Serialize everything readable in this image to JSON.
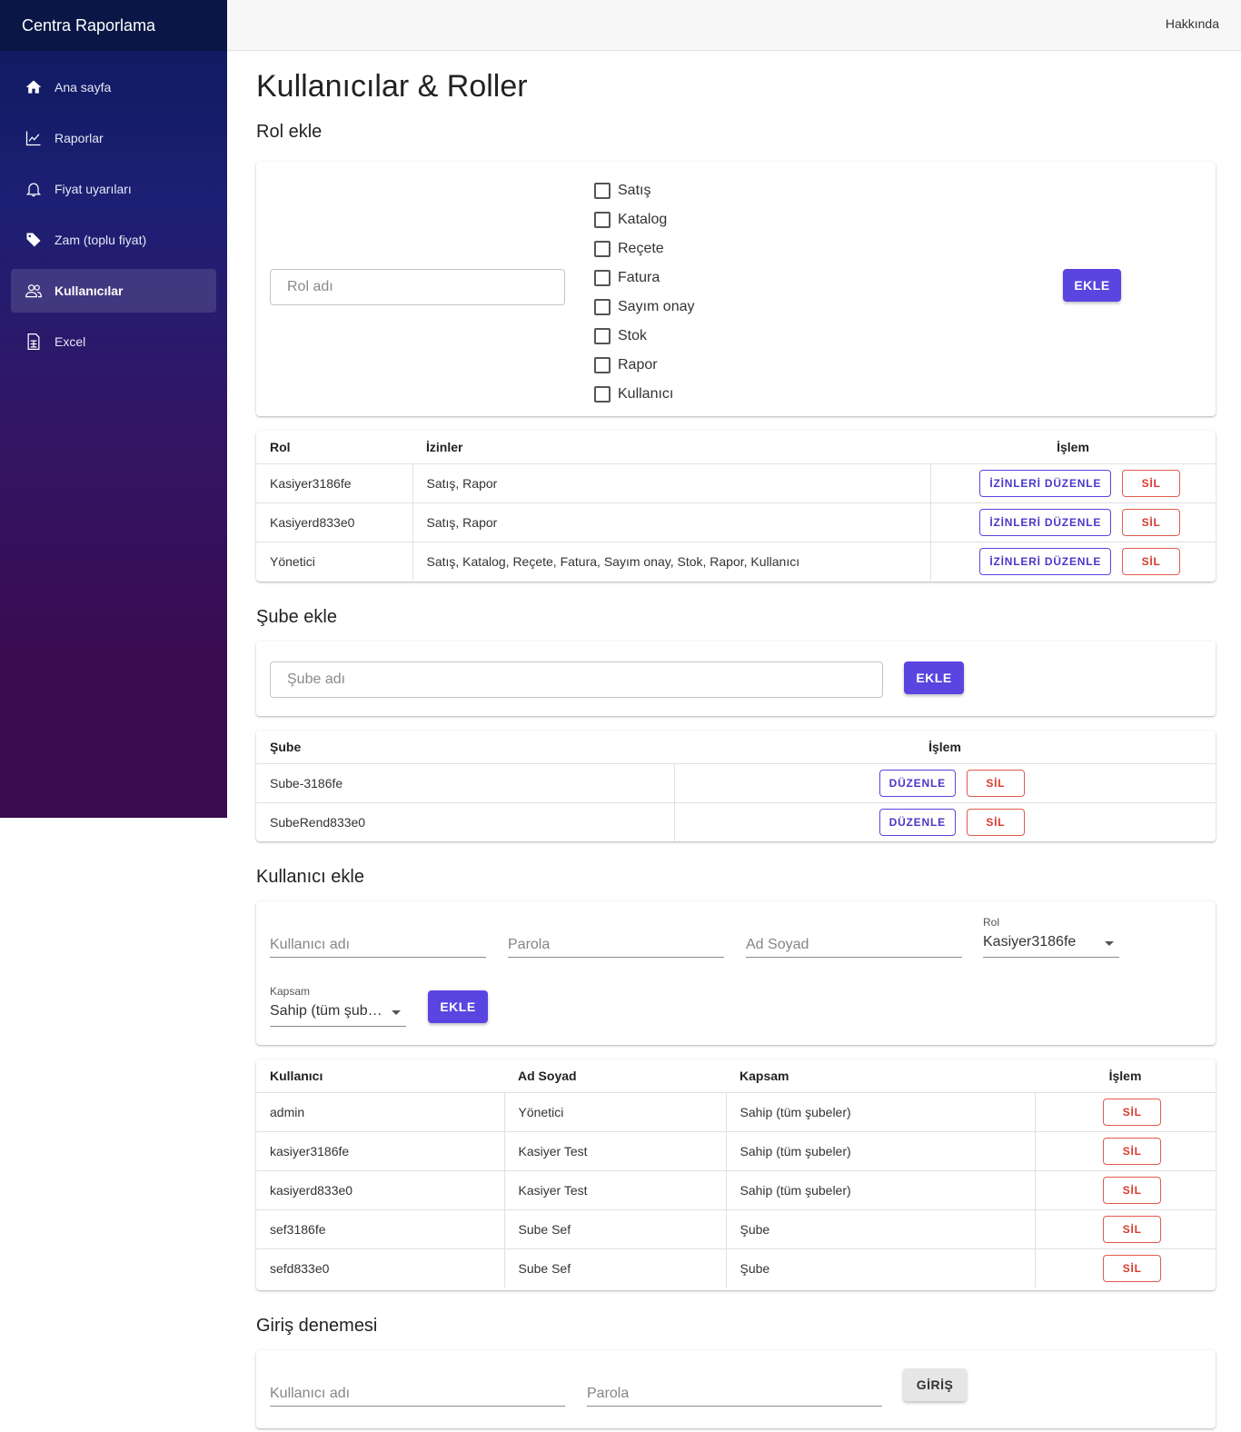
{
  "app": {
    "title": "Centra Raporlama",
    "about": "Hakkında"
  },
  "sidebar": {
    "items": [
      {
        "label": "Ana sayfa",
        "icon": "home-icon"
      },
      {
        "label": "Raporlar",
        "icon": "chart-icon"
      },
      {
        "label": "Fiyat uyarıları",
        "icon": "bell-icon"
      },
      {
        "label": "Zam (toplu fiyat)",
        "icon": "tag-icon"
      },
      {
        "label": "Kullanıcılar",
        "icon": "users-icon",
        "active": true
      },
      {
        "label": "Excel",
        "icon": "spreadsheet-icon"
      }
    ]
  },
  "page": {
    "title": "Kullanıcılar & Roller"
  },
  "role_add": {
    "title": "Rol ekle",
    "name_placeholder": "Rol adı",
    "permissions": [
      "Satış",
      "Katalog",
      "Reçete",
      "Fatura",
      "Sayım onay",
      "Stok",
      "Rapor",
      "Kullanıcı"
    ],
    "add_label": "EKLE"
  },
  "roles_table": {
    "headers": {
      "role": "Rol",
      "permissions": "İzinler",
      "action": "İşlem"
    },
    "rows": [
      {
        "role": "Kasiyer3186fe",
        "permissions": "Satış, Rapor"
      },
      {
        "role": "Kasiyerd833e0",
        "permissions": "Satış, Rapor"
      },
      {
        "role": "Yönetici",
        "permissions": "Satış, Katalog, Reçete, Fatura, Sayım onay, Stok, Rapor, Kullanıcı"
      }
    ],
    "edit_label": "İZİNLERİ DÜZENLE",
    "delete_label": "SİL"
  },
  "branch_add": {
    "title": "Şube ekle",
    "placeholder": "Şube adı",
    "add_label": "EKLE"
  },
  "branches_table": {
    "headers": {
      "branch": "Şube",
      "action": "İşlem"
    },
    "rows": [
      {
        "branch": "Sube-3186fe"
      },
      {
        "branch": "SubeRend833e0"
      }
    ],
    "edit_label": "DÜZENLE",
    "delete_label": "SİL"
  },
  "user_add": {
    "title": "Kullanıcı ekle",
    "username_placeholder": "Kullanıcı adı",
    "password_placeholder": "Parola",
    "fullname_placeholder": "Ad Soyad",
    "role_label": "Rol",
    "role_value": "Kasiyer3186fe",
    "scope_label": "Kapsam",
    "scope_value": "Sahip (tüm şub…",
    "add_label": "EKLE"
  },
  "users_table": {
    "headers": {
      "user": "Kullanıcı",
      "fullname": "Ad Soyad",
      "scope": "Kapsam",
      "action": "İşlem"
    },
    "rows": [
      {
        "user": "admin",
        "fullname": "Yönetici",
        "scope": "Sahip (tüm şubeler)"
      },
      {
        "user": "kasiyer3186fe",
        "fullname": "Kasiyer Test",
        "scope": "Sahip (tüm şubeler)"
      },
      {
        "user": "kasiyerd833e0",
        "fullname": "Kasiyer Test",
        "scope": "Sahip (tüm şubeler)"
      },
      {
        "user": "sef3186fe",
        "fullname": "Sube Sef",
        "scope": "Şube"
      },
      {
        "user": "sefd833e0",
        "fullname": "Sube Sef",
        "scope": "Şube"
      }
    ],
    "delete_label": "SİL"
  },
  "login_test": {
    "title": "Giriş denemesi",
    "username_placeholder": "Kullanıcı adı",
    "password_placeholder": "Parola",
    "submit_label": "GİRİŞ"
  },
  "colors": {
    "primary": "#5b45e0",
    "danger": "#d83a2e",
    "sidebar_top": "#0c1a5c",
    "sidebar_bottom": "#3a0b4f"
  }
}
